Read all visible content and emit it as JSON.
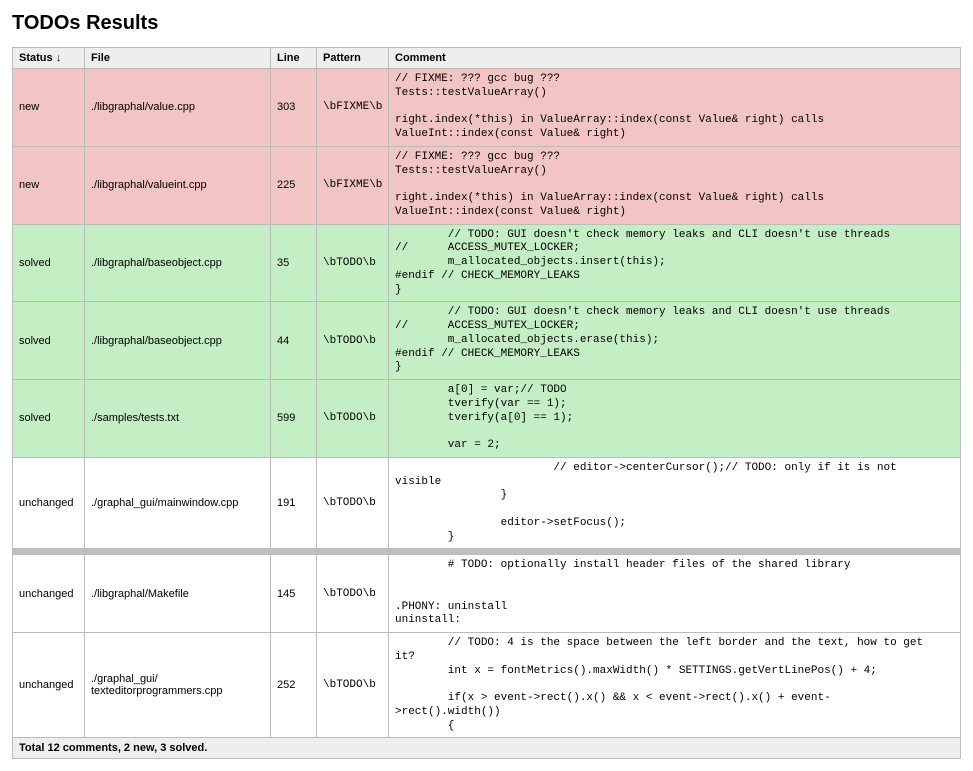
{
  "title": "TODOs Results",
  "columns": {
    "status": "Status",
    "sort_indicator": "↓",
    "file": "File",
    "line": "Line",
    "pattern": "Pattern",
    "comment": "Comment"
  },
  "rows": [
    {
      "status": "new",
      "file": "./libgraphal/value.cpp",
      "line": "303",
      "pattern": "\\bFIXME\\b",
      "comment": "// FIXME: ??? gcc bug ???\nTests::testValueArray()\n\nright.index(*this) in ValueArray::index(const Value& right) calls\nValueInt::index(const Value& right)"
    },
    {
      "status": "new",
      "file": "./libgraphal/valueint.cpp",
      "line": "225",
      "pattern": "\\bFIXME\\b",
      "comment": "// FIXME: ??? gcc bug ???\nTests::testValueArray()\n\nright.index(*this) in ValueArray::index(const Value& right) calls\nValueInt::index(const Value& right)"
    },
    {
      "status": "solved",
      "file": "./libgraphal/baseobject.cpp",
      "line": "35",
      "pattern": "\\bTODO\\b",
      "comment": "        // TODO: GUI doesn't check memory leaks and CLI doesn't use threads\n//      ACCESS_MUTEX_LOCKER;\n        m_allocated_objects.insert(this);\n#endif // CHECK_MEMORY_LEAKS\n}"
    },
    {
      "status": "solved",
      "file": "./libgraphal/baseobject.cpp",
      "line": "44",
      "pattern": "\\bTODO\\b",
      "comment": "        // TODO: GUI doesn't check memory leaks and CLI doesn't use threads\n//      ACCESS_MUTEX_LOCKER;\n        m_allocated_objects.erase(this);\n#endif // CHECK_MEMORY_LEAKS\n}"
    },
    {
      "status": "solved",
      "file": "./samples/tests.txt",
      "line": "599",
      "pattern": "\\bTODO\\b",
      "comment": "        a[0] = var;// TODO\n        tverify(var == 1);\n        tverify(a[0] == 1);\n\n        var = 2;"
    },
    {
      "status": "unchanged",
      "file": "./graphal_gui/mainwindow.cpp",
      "line": "191",
      "pattern": "\\bTODO\\b",
      "comment": "                        // editor->centerCursor();// TODO: only if it is not\nvisible\n                }\n\n                editor->setFocus();\n        }"
    },
    {
      "separator": true
    },
    {
      "status": "unchanged",
      "file": "./libgraphal/Makefile",
      "line": "145",
      "pattern": "\\bTODO\\b",
      "comment": "        # TODO: optionally install header files of the shared library\n\n\n.PHONY: uninstall\nuninstall:"
    },
    {
      "status": "unchanged",
      "file": "./graphal_gui/texteditorprogrammers.cpp",
      "line": "252",
      "pattern": "\\bTODO\\b",
      "comment": "        // TODO: 4 is the space between the left border and the text, how to get\nit?\n        int x = fontMetrics().maxWidth() * SETTINGS.getVertLinePos() + 4;\n\n        if(x > event->rect().x() && x < event->rect().x() + event-\n>rect().width())\n        {"
    }
  ],
  "footer": "Total 12 comments, 2 new, 3 solved."
}
